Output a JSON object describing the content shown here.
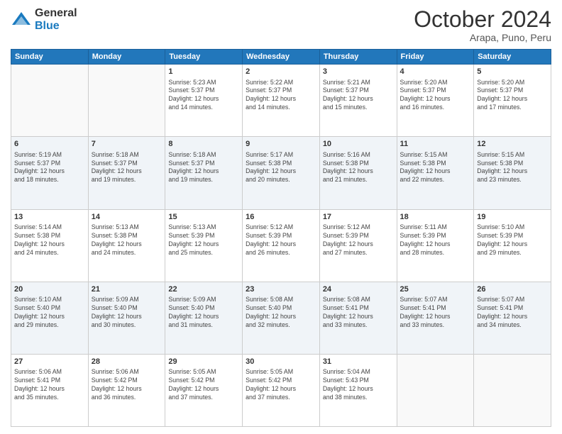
{
  "logo": {
    "general": "General",
    "blue": "Blue"
  },
  "header": {
    "month": "October 2024",
    "location": "Arapa, Puno, Peru"
  },
  "weekdays": [
    "Sunday",
    "Monday",
    "Tuesday",
    "Wednesday",
    "Thursday",
    "Friday",
    "Saturday"
  ],
  "weeks": [
    [
      {
        "day": "",
        "info": ""
      },
      {
        "day": "",
        "info": ""
      },
      {
        "day": "1",
        "info": "Sunrise: 5:23 AM\nSunset: 5:37 PM\nDaylight: 12 hours\nand 14 minutes."
      },
      {
        "day": "2",
        "info": "Sunrise: 5:22 AM\nSunset: 5:37 PM\nDaylight: 12 hours\nand 14 minutes."
      },
      {
        "day": "3",
        "info": "Sunrise: 5:21 AM\nSunset: 5:37 PM\nDaylight: 12 hours\nand 15 minutes."
      },
      {
        "day": "4",
        "info": "Sunrise: 5:20 AM\nSunset: 5:37 PM\nDaylight: 12 hours\nand 16 minutes."
      },
      {
        "day": "5",
        "info": "Sunrise: 5:20 AM\nSunset: 5:37 PM\nDaylight: 12 hours\nand 17 minutes."
      }
    ],
    [
      {
        "day": "6",
        "info": "Sunrise: 5:19 AM\nSunset: 5:37 PM\nDaylight: 12 hours\nand 18 minutes."
      },
      {
        "day": "7",
        "info": "Sunrise: 5:18 AM\nSunset: 5:37 PM\nDaylight: 12 hours\nand 19 minutes."
      },
      {
        "day": "8",
        "info": "Sunrise: 5:18 AM\nSunset: 5:37 PM\nDaylight: 12 hours\nand 19 minutes."
      },
      {
        "day": "9",
        "info": "Sunrise: 5:17 AM\nSunset: 5:38 PM\nDaylight: 12 hours\nand 20 minutes."
      },
      {
        "day": "10",
        "info": "Sunrise: 5:16 AM\nSunset: 5:38 PM\nDaylight: 12 hours\nand 21 minutes."
      },
      {
        "day": "11",
        "info": "Sunrise: 5:15 AM\nSunset: 5:38 PM\nDaylight: 12 hours\nand 22 minutes."
      },
      {
        "day": "12",
        "info": "Sunrise: 5:15 AM\nSunset: 5:38 PM\nDaylight: 12 hours\nand 23 minutes."
      }
    ],
    [
      {
        "day": "13",
        "info": "Sunrise: 5:14 AM\nSunset: 5:38 PM\nDaylight: 12 hours\nand 24 minutes."
      },
      {
        "day": "14",
        "info": "Sunrise: 5:13 AM\nSunset: 5:38 PM\nDaylight: 12 hours\nand 24 minutes."
      },
      {
        "day": "15",
        "info": "Sunrise: 5:13 AM\nSunset: 5:39 PM\nDaylight: 12 hours\nand 25 minutes."
      },
      {
        "day": "16",
        "info": "Sunrise: 5:12 AM\nSunset: 5:39 PM\nDaylight: 12 hours\nand 26 minutes."
      },
      {
        "day": "17",
        "info": "Sunrise: 5:12 AM\nSunset: 5:39 PM\nDaylight: 12 hours\nand 27 minutes."
      },
      {
        "day": "18",
        "info": "Sunrise: 5:11 AM\nSunset: 5:39 PM\nDaylight: 12 hours\nand 28 minutes."
      },
      {
        "day": "19",
        "info": "Sunrise: 5:10 AM\nSunset: 5:39 PM\nDaylight: 12 hours\nand 29 minutes."
      }
    ],
    [
      {
        "day": "20",
        "info": "Sunrise: 5:10 AM\nSunset: 5:40 PM\nDaylight: 12 hours\nand 29 minutes."
      },
      {
        "day": "21",
        "info": "Sunrise: 5:09 AM\nSunset: 5:40 PM\nDaylight: 12 hours\nand 30 minutes."
      },
      {
        "day": "22",
        "info": "Sunrise: 5:09 AM\nSunset: 5:40 PM\nDaylight: 12 hours\nand 31 minutes."
      },
      {
        "day": "23",
        "info": "Sunrise: 5:08 AM\nSunset: 5:40 PM\nDaylight: 12 hours\nand 32 minutes."
      },
      {
        "day": "24",
        "info": "Sunrise: 5:08 AM\nSunset: 5:41 PM\nDaylight: 12 hours\nand 33 minutes."
      },
      {
        "day": "25",
        "info": "Sunrise: 5:07 AM\nSunset: 5:41 PM\nDaylight: 12 hours\nand 33 minutes."
      },
      {
        "day": "26",
        "info": "Sunrise: 5:07 AM\nSunset: 5:41 PM\nDaylight: 12 hours\nand 34 minutes."
      }
    ],
    [
      {
        "day": "27",
        "info": "Sunrise: 5:06 AM\nSunset: 5:41 PM\nDaylight: 12 hours\nand 35 minutes."
      },
      {
        "day": "28",
        "info": "Sunrise: 5:06 AM\nSunset: 5:42 PM\nDaylight: 12 hours\nand 36 minutes."
      },
      {
        "day": "29",
        "info": "Sunrise: 5:05 AM\nSunset: 5:42 PM\nDaylight: 12 hours\nand 37 minutes."
      },
      {
        "day": "30",
        "info": "Sunrise: 5:05 AM\nSunset: 5:42 PM\nDaylight: 12 hours\nand 37 minutes."
      },
      {
        "day": "31",
        "info": "Sunrise: 5:04 AM\nSunset: 5:43 PM\nDaylight: 12 hours\nand 38 minutes."
      },
      {
        "day": "",
        "info": ""
      },
      {
        "day": "",
        "info": ""
      }
    ]
  ]
}
